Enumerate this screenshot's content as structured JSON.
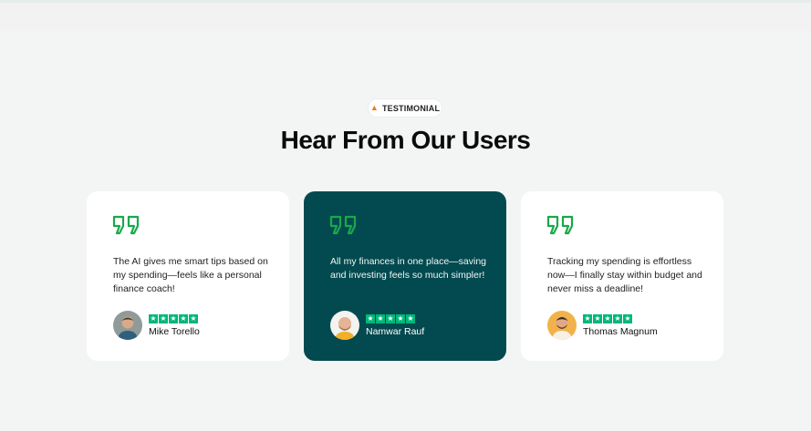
{
  "section": {
    "badge_label": "TESTIMONIAL",
    "heading": "Hear From Our Users"
  },
  "colors": {
    "accent_green": "#1aa84b",
    "dark_card": "#024a4f",
    "star_green": "#00b67a"
  },
  "testimonials": [
    {
      "text": "The AI gives me smart tips based on my spending—feels like a personal finance coach!",
      "name": "Mike Torello",
      "rating": 5,
      "highlighted": false
    },
    {
      "text": "All my finances in one place—saving and investing feels so much simpler!",
      "name": "Namwar Rauf",
      "rating": 5,
      "highlighted": true
    },
    {
      "text": "Tracking my spending is effortless now—I finally stay within budget and never miss a deadline!",
      "name": "Thomas Magnum",
      "rating": 5,
      "highlighted": false
    }
  ]
}
